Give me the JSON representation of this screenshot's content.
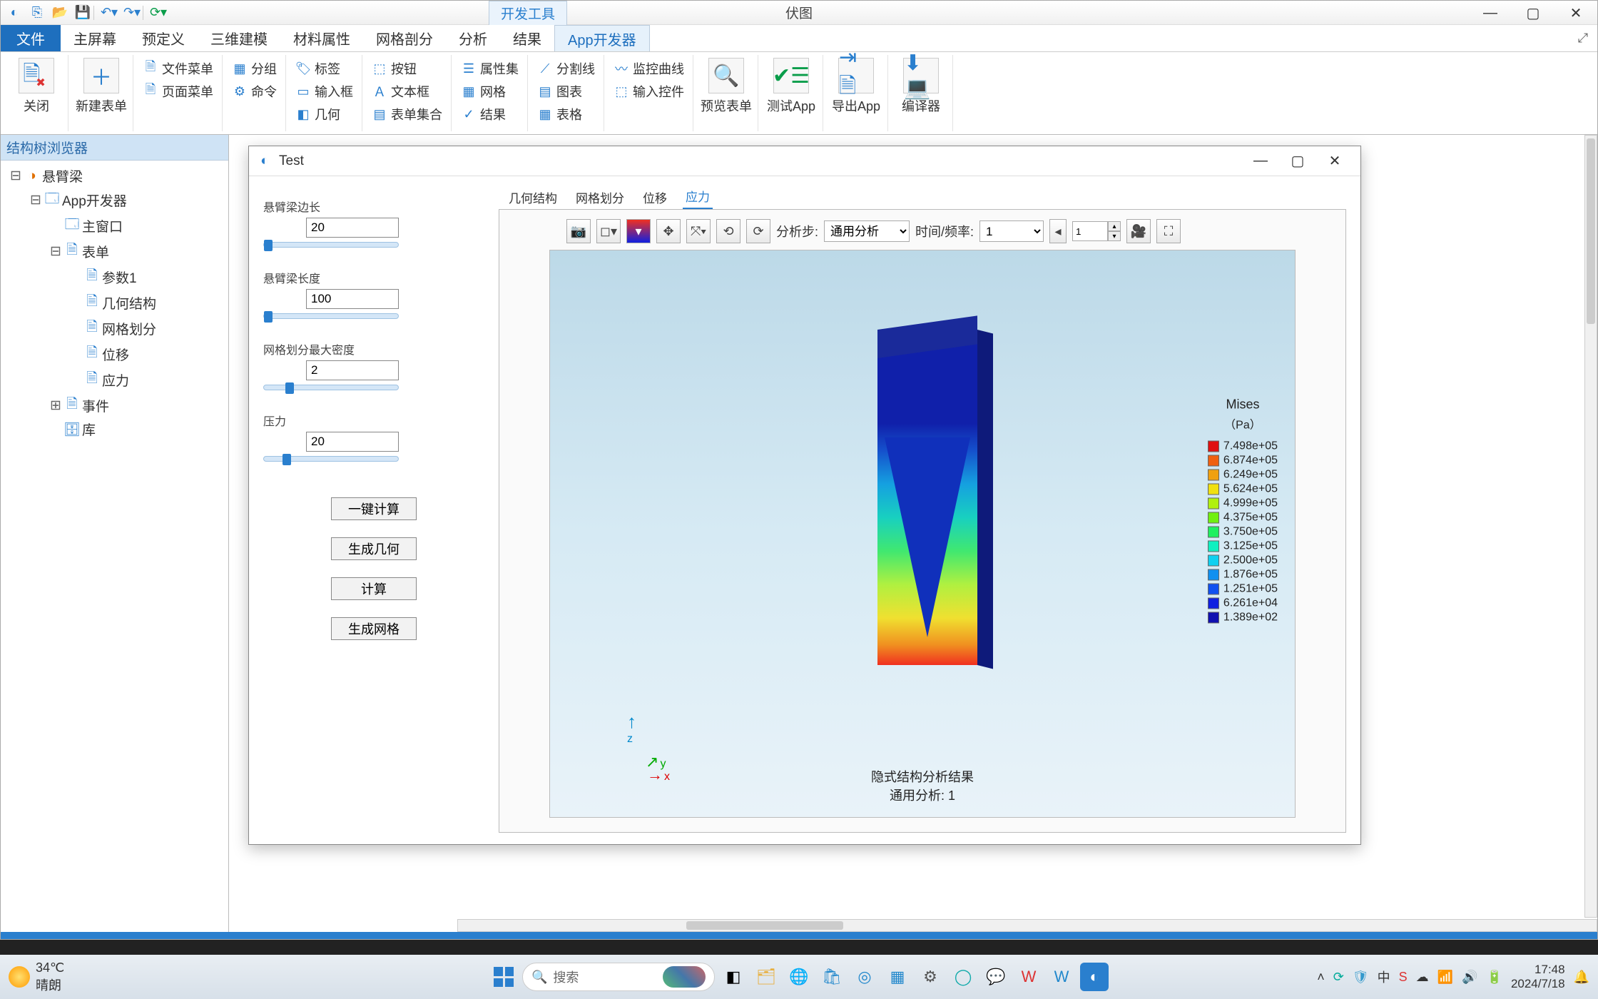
{
  "window": {
    "tool_tab": "开发工具",
    "app_title": "伏图",
    "win_min": "—",
    "win_max": "▢",
    "win_close": "✕",
    "file_tab": "文件",
    "tabs": [
      "主屏幕",
      "预定义",
      "三维建模",
      "材料属性",
      "网格剖分",
      "分析",
      "结果",
      "App开发器"
    ],
    "active_tab": 7
  },
  "ribbon": {
    "big1": "关闭",
    "big2": "新建表单",
    "col1": [
      "文件菜单",
      "页面菜单"
    ],
    "col2": [
      "分组",
      "命令"
    ],
    "col3": [
      "标签",
      "输入框",
      "几何"
    ],
    "col4": [
      "按钮",
      "文本框",
      "表单集合"
    ],
    "col5": [
      "属性集",
      "网格",
      "结果"
    ],
    "col6": [
      "分割线",
      "图表",
      "表格"
    ],
    "col7": [
      "监控曲线",
      "输入控件"
    ],
    "big3": "预览表单",
    "big4": "测试App",
    "big5": "导出App",
    "big6": "编译器"
  },
  "tree_panel_title": "结构树浏览器",
  "tree": {
    "root": "悬臂梁",
    "app": "App开发器",
    "mainwin": "主窗口",
    "forms": "表单",
    "form_children": [
      "参数1",
      "几何结构",
      "网格划分",
      "位移",
      "应力"
    ],
    "events": "事件",
    "library": "库"
  },
  "test_window": {
    "title": "Test",
    "min": "—",
    "max": "▢",
    "close": "✕",
    "params": [
      {
        "label": "悬臂梁边长",
        "value": "20",
        "knob": 0
      },
      {
        "label": "悬臂梁长度",
        "value": "100",
        "knob": 0
      },
      {
        "label": "网格划分最大密度",
        "value": "2",
        "knob": 30
      },
      {
        "label": "压力",
        "value": "20",
        "knob": 26
      }
    ],
    "buttons": [
      "一键计算",
      "生成几何",
      "计算",
      "生成网格"
    ],
    "viz_tabs": [
      "几何结构",
      "网格划分",
      "位移",
      "应力"
    ],
    "viz_active": 3
  },
  "viz": {
    "toolbar": {
      "step_label": "分析步:",
      "step_select": "通用分析",
      "time_label": "时间/频率:",
      "time_select": "1",
      "frame_value": "1"
    },
    "caption_line1": "隐式结构分析结果",
    "caption_line2": "通用分析: 1",
    "triad": {
      "x": "x",
      "y": "y",
      "z": "z"
    }
  },
  "chart_data": {
    "type": "heatmap",
    "title": "Mises",
    "unit": "（Pa）",
    "legend": [
      {
        "color": "#e01010",
        "label": "7.498e+05"
      },
      {
        "color": "#f06010",
        "label": "6.874e+05"
      },
      {
        "color": "#f0a010",
        "label": "6.249e+05"
      },
      {
        "color": "#f0e010",
        "label": "5.624e+05"
      },
      {
        "color": "#b0f010",
        "label": "4.999e+05"
      },
      {
        "color": "#70f010",
        "label": "4.375e+05"
      },
      {
        "color": "#20f060",
        "label": "3.750e+05"
      },
      {
        "color": "#10f0c0",
        "label": "3.125e+05"
      },
      {
        "color": "#10d0f0",
        "label": "2.500e+05"
      },
      {
        "color": "#1090f0",
        "label": "1.876e+05"
      },
      {
        "color": "#1050f0",
        "label": "1.251e+05"
      },
      {
        "color": "#1020e0",
        "label": "6.261e+04"
      },
      {
        "color": "#1010b0",
        "label": "1.389e+02"
      }
    ]
  },
  "taskbar": {
    "temp": "34℃",
    "weather": "晴朗",
    "search_placeholder": "搜索",
    "time": "17:48",
    "date": "2024/7/18"
  }
}
